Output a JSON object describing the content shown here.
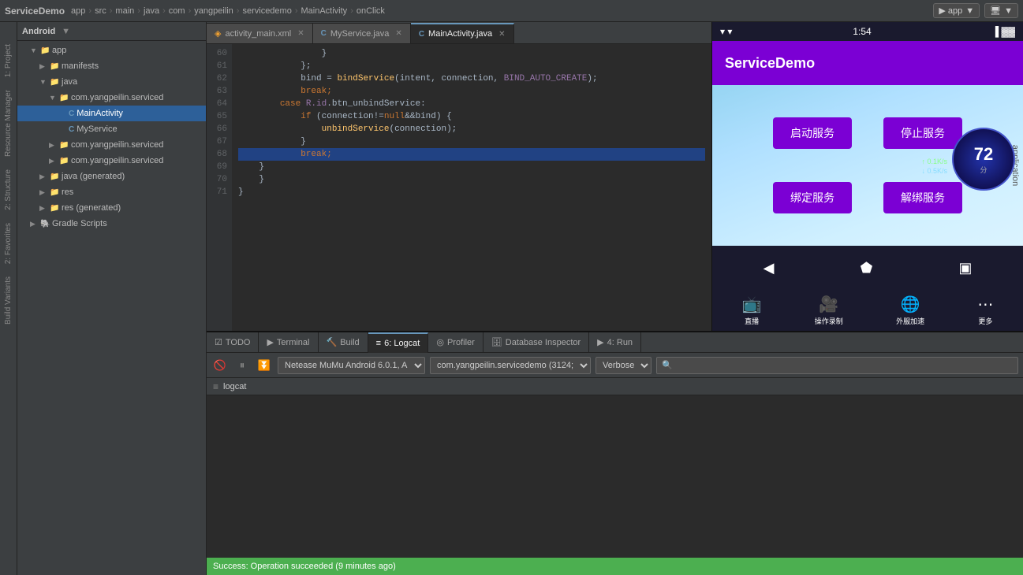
{
  "topbar": {
    "brand": "ServiceDemo",
    "breadcrumb": [
      "app",
      "src",
      "main",
      "java",
      "com",
      "yangpeilin",
      "servicedemo",
      "MainActivity",
      "onClick"
    ],
    "run_label": "▶ app",
    "device_selector": "▼"
  },
  "editor": {
    "tabs": [
      {
        "id": "activity_main",
        "label": "activity_main.xml",
        "icon": "",
        "type": "xml",
        "active": false
      },
      {
        "id": "myservice",
        "label": "MyService.java",
        "icon": "C",
        "type": "java",
        "active": false
      },
      {
        "id": "mainactivity",
        "label": "MainActivity.java",
        "icon": "C",
        "type": "java",
        "active": true
      }
    ],
    "code_lines": [
      {
        "num": 60,
        "content": "                }",
        "highlight": false
      },
      {
        "num": 61,
        "content": "            };",
        "highlight": false
      },
      {
        "num": 62,
        "content": "            bind = bindService(intent, connection, BIND_AUTO_CREATE);",
        "highlight": false
      },
      {
        "num": 63,
        "content": "            break;",
        "highlight": false
      },
      {
        "num": 64,
        "content": "        case R.id.btn_unbindService:",
        "highlight": false
      },
      {
        "num": 65,
        "content": "            if (connection!=null&&bind) {",
        "highlight": false
      },
      {
        "num": 66,
        "content": "                unbindService(connection);",
        "highlight": false
      },
      {
        "num": 67,
        "content": "            }",
        "highlight": false
      },
      {
        "num": 68,
        "content": "            break;",
        "highlight": true
      },
      {
        "num": 69,
        "content": "    }",
        "highlight": false
      },
      {
        "num": 70,
        "content": "    }",
        "highlight": false
      },
      {
        "num": 71,
        "content": "}",
        "highlight": false
      }
    ]
  },
  "project_panel": {
    "title": "1: Project",
    "tree": [
      {
        "indent": 0,
        "label": "Android",
        "icon": "android",
        "expanded": true,
        "chevron": "▼"
      },
      {
        "indent": 1,
        "label": "app",
        "icon": "folder",
        "expanded": true,
        "chevron": "▼"
      },
      {
        "indent": 2,
        "label": "manifests",
        "icon": "folder",
        "expanded": false,
        "chevron": "▶"
      },
      {
        "indent": 2,
        "label": "java",
        "icon": "folder",
        "expanded": true,
        "chevron": "▼"
      },
      {
        "indent": 3,
        "label": "com.yangpeilin.serviced",
        "icon": "folder",
        "expanded": true,
        "chevron": "▼"
      },
      {
        "indent": 4,
        "label": "MainActivity",
        "icon": "java",
        "expanded": false,
        "chevron": ""
      },
      {
        "indent": 4,
        "label": "MyService",
        "icon": "java",
        "expanded": false,
        "chevron": ""
      },
      {
        "indent": 3,
        "label": "com.yangpeilin.serviced",
        "icon": "folder",
        "expanded": false,
        "chevron": "▶"
      },
      {
        "indent": 3,
        "label": "com.yangpeilin.serviced",
        "icon": "folder",
        "expanded": false,
        "chevron": "▶"
      },
      {
        "indent": 2,
        "label": "java (generated)",
        "icon": "folder",
        "expanded": false,
        "chevron": "▶"
      },
      {
        "indent": 2,
        "label": "res",
        "icon": "folder",
        "expanded": false,
        "chevron": "▶"
      },
      {
        "indent": 2,
        "label": "res (generated)",
        "icon": "folder",
        "expanded": false,
        "chevron": "▶"
      },
      {
        "indent": 1,
        "label": "Gradle Scripts",
        "icon": "folder",
        "expanded": false,
        "chevron": "▶"
      }
    ]
  },
  "emulator": {
    "app_title": "ServiceDemo",
    "status_time": "1:54",
    "buttons": {
      "start_service": "启动服务",
      "stop_service": "停止服务",
      "bind_service": "绑定服务",
      "unbind_service": "解绑服务"
    },
    "app_label": "application",
    "nav_back": "◀",
    "nav_home": "⬟",
    "nav_recent": "▣",
    "perf_num": "72",
    "perf_unit": "分",
    "perf_up": "↑ 0.1K/s",
    "perf_down": "↓ 0.5K/s",
    "bottom_bar": [
      {
        "icon": "📺",
        "label": "直播"
      },
      {
        "icon": "🎮",
        "label": "操作录制"
      },
      {
        "icon": "🔍",
        "label": "外服加速"
      },
      {
        "icon": "⋯",
        "label": "更多"
      }
    ]
  },
  "logcat": {
    "title": "logcat",
    "device_selector": "Netease MuMu Android 6.0.1, A",
    "package_selector": "com.yangpeilin.servicedemo (3124;",
    "level_selector": "Verbose",
    "search_placeholder": "🔍"
  },
  "bottom_tabs": [
    {
      "id": "todo",
      "label": "TODO",
      "icon": "☑",
      "active": false
    },
    {
      "id": "terminal",
      "label": "Terminal",
      "icon": "▶",
      "active": false
    },
    {
      "id": "build",
      "label": "Build",
      "icon": "🔨",
      "active": false
    },
    {
      "id": "logcat",
      "label": "6: Logcat",
      "icon": "≡",
      "active": true
    },
    {
      "id": "profiler",
      "label": "Profiler",
      "icon": "◎",
      "active": false
    },
    {
      "id": "database_inspector",
      "label": "Database Inspector",
      "icon": "🗄",
      "active": false
    },
    {
      "id": "run",
      "label": "4: Run",
      "icon": "▶",
      "active": false
    }
  ],
  "side_tabs": [
    {
      "id": "project",
      "label": "1: Project",
      "active": false
    },
    {
      "id": "structure",
      "label": "2: Structure",
      "active": false
    },
    {
      "id": "favorites",
      "label": "2: Favorites",
      "active": false
    },
    {
      "id": "build_variants",
      "label": "Build Variants",
      "active": false
    }
  ],
  "statusbar": {
    "text": "Success: Operation succeeded (9 minutes ago)"
  }
}
